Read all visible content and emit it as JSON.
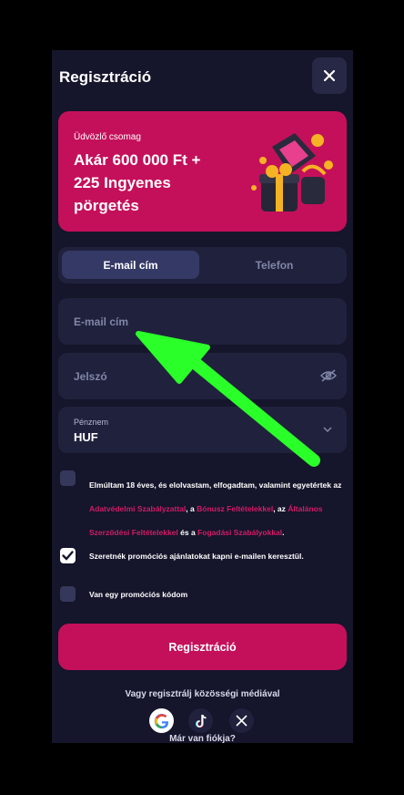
{
  "dialog": {
    "title": "Regisztráció"
  },
  "promo": {
    "welcome": "Üdvözlő csomag",
    "headline": "Akár 600 000 Ft + 225 Ingyenes pörgetés"
  },
  "tabs": {
    "email": "E-mail cím",
    "phone": "Telefon"
  },
  "fields": {
    "email_placeholder": "E-mail cím",
    "password_placeholder": "Jelszó",
    "currency_label": "Pénznem",
    "currency_value": "HUF"
  },
  "consent": {
    "part1": "Elmúltam 18 éves, és elolvastam, elfogadtam, valamint egyetértek az ",
    "link1": "Adatvédelmi Szabályzattal",
    "part2": ", a ",
    "link2": "Bónusz Feltételekkel",
    "part3": ", az ",
    "link3": "Általános Szerződési Feltételekkel",
    "part4": " és a ",
    "link4": "Fogadási Szabályokkal",
    "part5": "."
  },
  "options": {
    "promo_emails": "Szeretnék promóciós ajánlatokat kapni e-mailen keresztül.",
    "promo_emails_checked": true,
    "promo_code": "Van egy promóciós kódom",
    "promo_code_checked": false,
    "age_checked": false
  },
  "register_button": "Regisztráció",
  "social": {
    "text": "Vagy regisztrálj közösségi médiával",
    "providers": [
      "google-icon",
      "tiktok-icon",
      "x-icon"
    ]
  },
  "login_prompt": "Már van fiókja?",
  "colors": {
    "accent": "#c4105a",
    "panel": "#15152b",
    "field": "#20223d",
    "arrow": "#2bff29"
  }
}
